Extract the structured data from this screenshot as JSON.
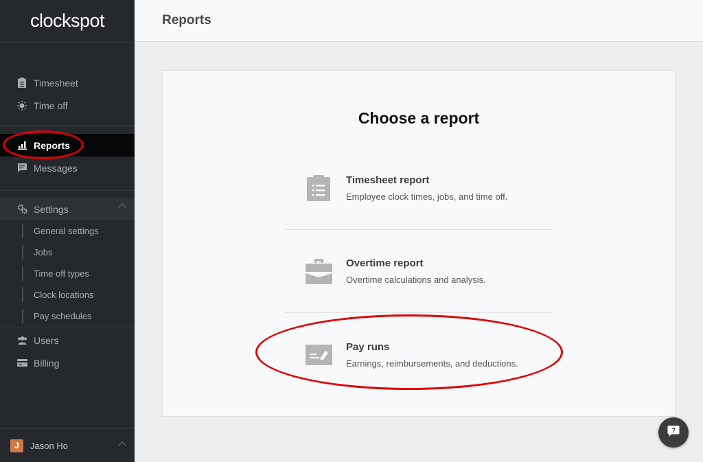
{
  "app": {
    "logo": "clockspot"
  },
  "sidebar": {
    "items": [
      {
        "label": "Timesheet",
        "icon": "clipboard-icon"
      },
      {
        "label": "Time off",
        "icon": "sun-icon"
      },
      {
        "label": "Reports",
        "icon": "bar-chart-icon",
        "active": true
      },
      {
        "label": "Messages",
        "icon": "message-icon"
      }
    ],
    "settings": {
      "label": "Settings",
      "icon": "gears-icon",
      "expanded": true,
      "children": [
        {
          "label": "General settings"
        },
        {
          "label": "Jobs"
        },
        {
          "label": "Time off types"
        },
        {
          "label": "Clock locations"
        },
        {
          "label": "Pay schedules"
        }
      ]
    },
    "bottom_items": [
      {
        "label": "Users",
        "icon": "users-icon"
      },
      {
        "label": "Billing",
        "icon": "credit-card-icon"
      }
    ],
    "user": {
      "initial": "J",
      "name": "Jason Ho",
      "avatar_color": "#d07a45"
    }
  },
  "header": {
    "title": "Reports"
  },
  "main": {
    "title": "Choose a report",
    "reports": [
      {
        "name": "Timesheet report",
        "description": "Employee clock times, jobs, and time off.",
        "icon": "clipboard-icon"
      },
      {
        "name": "Overtime report",
        "description": "Overtime calculations and analysis.",
        "icon": "briefcase-icon"
      },
      {
        "name": "Pay runs",
        "description": "Earnings, reimbursements, and deductions.",
        "icon": "pay-check-icon"
      }
    ]
  },
  "help": {
    "icon": "help-chat-icon",
    "glyph": "?"
  },
  "colors": {
    "annotation": "#e00000",
    "sidebar_bg": "#25282c",
    "active_bg": "#060708"
  }
}
